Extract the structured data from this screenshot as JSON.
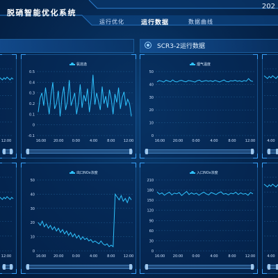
{
  "header": {
    "title": "脱硝智能优化系统",
    "clock": "202",
    "nav": [
      {
        "label": "运行优化"
      },
      {
        "label": "运行数据"
      },
      {
        "label": "数据曲线"
      }
    ]
  },
  "panel": {
    "title": "SCR3-2运行数据"
  },
  "colors": {
    "line": "#2fc4ff",
    "grid": "#1f5a8f",
    "axis_text": "#cfe3ff"
  },
  "charts": [
    {
      "id": "left-top",
      "x_ticks": [
        "12:00"
      ],
      "y_ticks": []
    },
    {
      "id": "mid-top",
      "legend": "氨逃逸",
      "x_ticks": [
        "16:00",
        "20:00",
        "0:00",
        "4:00",
        "8:00",
        "12:00"
      ],
      "y_ticks": [
        "0.5",
        "0.4",
        "0.3",
        "0.2",
        "0.1",
        "0",
        "-0.1"
      ]
    },
    {
      "id": "right-top",
      "legend": "烟气温度",
      "x_ticks": [
        "16:00",
        "20:00",
        "0:00",
        "4:00",
        "8:00",
        "12:00"
      ],
      "y_ticks": [
        "50",
        "40",
        "30",
        "20",
        "10",
        "0"
      ]
    },
    {
      "id": "edge-top",
      "x_ticks": [
        "4:00"
      ],
      "y_ticks": []
    },
    {
      "id": "left-bottom",
      "x_ticks": [
        "12:00"
      ],
      "y_ticks": []
    },
    {
      "id": "mid-bottom",
      "legend": "出口NOx浓度",
      "x_ticks": [
        "16:00",
        "20:00",
        "0:00",
        "4:00",
        "8:00",
        "12:00"
      ],
      "y_ticks": [
        "50",
        "40",
        "30",
        "20",
        "10",
        "0"
      ]
    },
    {
      "id": "right-bottom",
      "legend": "入口NOx浓度",
      "x_ticks": [
        "16:00",
        "20:00",
        "0:00",
        "4:00",
        "8:00",
        "12:00"
      ],
      "y_ticks": [
        "210",
        "180",
        "150",
        "120",
        "90",
        "60",
        "30",
        "0"
      ]
    },
    {
      "id": "edge-bottom",
      "x_ticks": [
        "4:00"
      ],
      "y_ticks": []
    }
  ],
  "chart_data": [
    {
      "type": "line",
      "series": [
        {
          "name": "氨逃逸",
          "values": [
            0.12,
            0.25,
            0.3,
            0.18,
            0.35,
            0.22,
            0.1,
            0.28,
            0.4,
            0.15,
            0.2,
            0.32,
            0.08,
            0.26,
            0.36,
            0.14,
            0.22,
            0.42,
            0.18,
            0.24,
            0.3,
            0.1,
            0.2,
            0.38,
            0.16,
            0.28,
            0.22,
            0.34,
            0.12,
            0.25,
            0.47,
            0.19,
            0.3,
            0.22,
            0.14,
            0.36,
            0.2,
            0.27,
            0.16,
            0.33,
            0.24,
            0.1,
            0.29,
            0.21,
            0.35,
            0.15,
            0.26,
            0.31,
            0.18,
            0.24,
            0.2,
            0.08
          ]
        }
      ],
      "x": [
        "16:00",
        "20:00",
        "0:00",
        "4:00",
        "8:00",
        "12:00"
      ],
      "ylim": [
        -0.1,
        0.5
      ]
    },
    {
      "type": "line",
      "series": [
        {
          "name": "烟气温度",
          "values": [
            42,
            43,
            42.5,
            41.8,
            43.2,
            42.6,
            42,
            43.5,
            42.2,
            41.9,
            42.8,
            43.1,
            42.4,
            42,
            43,
            42.7,
            42.3,
            41.8,
            42.9,
            43.3,
            42.1,
            42.6,
            43,
            42.4,
            42.8,
            42.2,
            43.1,
            42.5,
            41.9,
            42.7,
            43.4,
            42.3,
            42,
            42.9,
            42.6,
            43.2,
            42.4,
            42.8,
            42.1,
            43,
            42.5,
            44.5,
            42.7,
            42.3
          ]
        }
      ],
      "x": [
        "16:00",
        "20:00",
        "0:00",
        "4:00",
        "8:00",
        "12:00"
      ],
      "ylim": [
        0,
        50
      ]
    },
    {
      "type": "line",
      "series": [
        {
          "name": "出口NOx浓度",
          "values": [
            20,
            18,
            21,
            17,
            19,
            16,
            18,
            15,
            17,
            14,
            16,
            13,
            15,
            12,
            14,
            11,
            13,
            10,
            12,
            9,
            11,
            8,
            10,
            8,
            9,
            7,
            8,
            6,
            7,
            6,
            5,
            7,
            5,
            4,
            5,
            3,
            4,
            3,
            40,
            38,
            36,
            39,
            35,
            37,
            34,
            38,
            36
          ]
        }
      ],
      "x": [
        "16:00",
        "20:00",
        "0:00",
        "4:00",
        "8:00",
        "12:00"
      ],
      "ylim": [
        0,
        50
      ]
    },
    {
      "type": "line",
      "series": [
        {
          "name": "入口NOx浓度",
          "values": [
            175,
            168,
            172,
            165,
            170,
            174,
            166,
            171,
            169,
            173,
            164,
            170,
            176,
            167,
            172,
            168,
            171,
            165,
            170,
            174,
            169,
            166,
            173,
            170,
            167,
            172,
            175,
            168,
            170,
            166,
            171,
            169,
            174,
            167,
            172,
            168,
            170,
            165,
            173,
            169
          ]
        }
      ],
      "x": [
        "16:00",
        "20:00",
        "0:00",
        "4:00",
        "8:00",
        "12:00"
      ],
      "ylim": [
        0,
        210
      ]
    }
  ]
}
